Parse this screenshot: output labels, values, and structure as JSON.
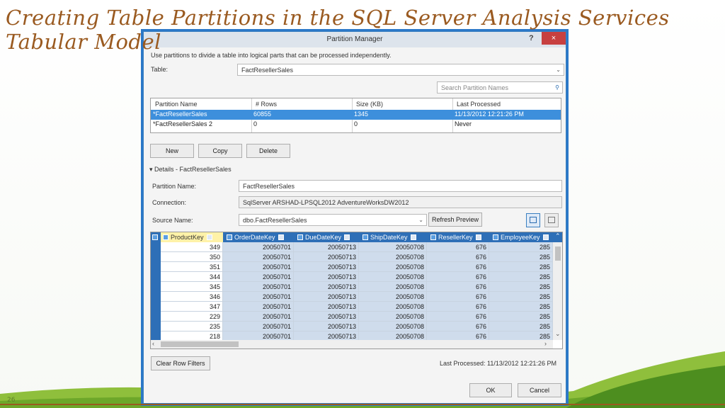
{
  "slide": {
    "title": "Creating Table Partitions in the SQL Server Analysis Services Tabular Model",
    "number": "26"
  },
  "dialog": {
    "title": "Partition Manager",
    "help": "?",
    "close": "×",
    "description": "Use partitions to divide a table into logical parts that can be processed independently.",
    "table_label": "Table:",
    "table_value": "FactResellerSales",
    "search_placeholder": "Search Partition Names",
    "partitions": {
      "columns": [
        "Partition Name",
        "# Rows",
        "Size (KB)",
        "Last Processed"
      ],
      "rows": [
        [
          "*FactResellerSales",
          "60855",
          "1345",
          "11/13/2012 12:21:26 PM"
        ],
        [
          "*FactResellerSales 2",
          "0",
          "0",
          "Never"
        ]
      ]
    },
    "buttons": {
      "new": "New",
      "copy": "Copy",
      "delete": "Delete"
    },
    "details_header": "Details - FactResellerSales",
    "partition_name_label": "Partition Name:",
    "partition_name_value": "FactResellerSales",
    "connection_label": "Connection:",
    "connection_value": "SqlServer ARSHAD-LPSQL2012 AdventureWorksDW2012",
    "source_label": "Source Name:",
    "source_value": "dbo.FactResellerSales",
    "refresh_preview": "Refresh Preview",
    "grid": {
      "columns": [
        "ProductKey",
        "OrderDateKey",
        "DueDateKey",
        "ShipDateKey",
        "ResellerKey",
        "EmployeeKey"
      ],
      "rows": [
        [
          "349",
          "20050701",
          "20050713",
          "20050708",
          "676",
          "285"
        ],
        [
          "350",
          "20050701",
          "20050713",
          "20050708",
          "676",
          "285"
        ],
        [
          "351",
          "20050701",
          "20050713",
          "20050708",
          "676",
          "285"
        ],
        [
          "344",
          "20050701",
          "20050713",
          "20050708",
          "676",
          "285"
        ],
        [
          "345",
          "20050701",
          "20050713",
          "20050708",
          "676",
          "285"
        ],
        [
          "346",
          "20050701",
          "20050713",
          "20050708",
          "676",
          "285"
        ],
        [
          "347",
          "20050701",
          "20050713",
          "20050708",
          "676",
          "285"
        ],
        [
          "229",
          "20050701",
          "20050713",
          "20050708",
          "676",
          "285"
        ],
        [
          "235",
          "20050701",
          "20050713",
          "20050708",
          "676",
          "285"
        ],
        [
          "218",
          "20050701",
          "20050713",
          "20050708",
          "676",
          "285"
        ]
      ]
    },
    "clear_row_filters": "Clear Row Filters",
    "last_processed": "Last Processed: 11/13/2012 12:21:26 PM",
    "ok": "OK",
    "cancel": "Cancel"
  }
}
